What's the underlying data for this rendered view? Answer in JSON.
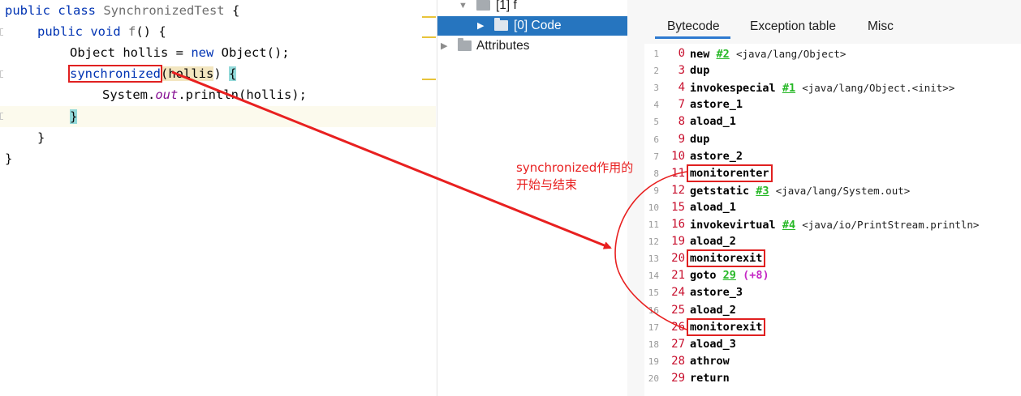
{
  "editor": {
    "lines": [
      {
        "kw1": "public ",
        "kw2": "class ",
        "name": "SynchronizedTest",
        "rest": " {"
      },
      {
        "kw1": "public ",
        "kw2": "void ",
        "name": "f",
        "rest": "() {"
      },
      {
        "a": "Object hollis = ",
        "kw": "new",
        "b": " Object();"
      },
      {
        "kw": "synchronized",
        "paren": "(",
        "var": "hollis",
        "close": ") ",
        "brace": "{"
      },
      {
        "a": "System.",
        "field": "out",
        "b": ".println(hollis);"
      },
      {
        "brace": "}"
      },
      {
        "text": "}"
      },
      {
        "text": "}"
      }
    ]
  },
  "tree": {
    "items": [
      {
        "label": "[1] f",
        "expanded": true
      },
      {
        "label": "[0] Code",
        "selected": true
      },
      {
        "label": "Attributes"
      }
    ]
  },
  "bytecode_panel": {
    "tabs": [
      "Bytecode",
      "Exception table",
      "Misc"
    ],
    "active_tab": "Bytecode",
    "rows": [
      {
        "line": "1",
        "offset": "0",
        "op": "new",
        "ref": "#2",
        "comment": "<java/lang/Object>"
      },
      {
        "line": "2",
        "offset": "3",
        "op": "dup"
      },
      {
        "line": "3",
        "offset": "4",
        "op": "invokespecial",
        "ref": "#1",
        "comment": "<java/lang/Object.<init>>"
      },
      {
        "line": "4",
        "offset": "7",
        "op": "astore_1"
      },
      {
        "line": "5",
        "offset": "8",
        "op": "aload_1"
      },
      {
        "line": "6",
        "offset": "9",
        "op": "dup"
      },
      {
        "line": "7",
        "offset": "10",
        "op": "astore_2"
      },
      {
        "line": "8",
        "offset": "11",
        "op": "monitorenter",
        "boxed": true
      },
      {
        "line": "9",
        "offset": "12",
        "op": "getstatic",
        "ref": "#3",
        "comment": "<java/lang/System.out>"
      },
      {
        "line": "10",
        "offset": "15",
        "op": "aload_1"
      },
      {
        "line": "11",
        "offset": "16",
        "op": "invokevirtual",
        "ref": "#4",
        "comment": "<java/io/PrintStream.println>"
      },
      {
        "line": "12",
        "offset": "19",
        "op": "aload_2"
      },
      {
        "line": "13",
        "offset": "20",
        "op": "monitorexit",
        "boxed": true
      },
      {
        "line": "14",
        "offset": "21",
        "op": "goto",
        "ref": "29",
        "delta": "(+8)"
      },
      {
        "line": "15",
        "offset": "24",
        "op": "astore_3"
      },
      {
        "line": "16",
        "offset": "25",
        "op": "aload_2"
      },
      {
        "line": "17",
        "offset": "26",
        "op": "monitorexit",
        "boxed": true
      },
      {
        "line": "18",
        "offset": "27",
        "op": "aload_3"
      },
      {
        "line": "19",
        "offset": "28",
        "op": "athrow"
      },
      {
        "line": "20",
        "offset": "29",
        "op": "return"
      }
    ]
  },
  "annotation": {
    "line1": "synchronized作用的",
    "line2": "开始与结束"
  },
  "colors": {
    "keyword": "#0033b3",
    "annotation_red": "#e82020",
    "selection": "#2675bf",
    "offset_red": "#c8102e",
    "ref_green": "#26b826",
    "tab_underline": "#2e7ad0"
  }
}
